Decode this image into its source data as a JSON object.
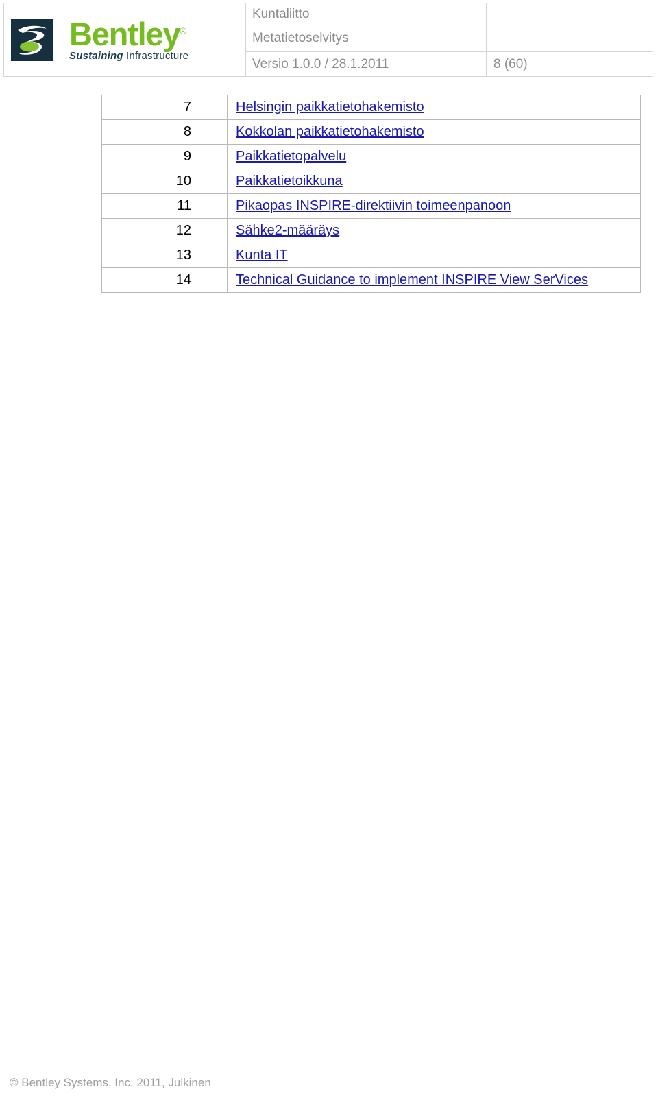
{
  "header": {
    "logo": {
      "mark_name": "bentley-b-mark",
      "wordmark": "Bentley",
      "registered_symbol": "®",
      "tagline_bold": "Sustaining",
      "tagline_regular": "Infrastructure",
      "brand_green": "#76bc21",
      "brand_navy": "#16303f"
    },
    "rows": [
      {
        "main": "Kuntaliitto",
        "side": ""
      },
      {
        "main": "Metatietoselvitys",
        "side": ""
      },
      {
        "main": "Versio 1.0.0 / 28.1.2011",
        "side": "8 (60)"
      }
    ]
  },
  "link_table": {
    "link_color": "#1a1aad",
    "rows": [
      {
        "num": "7",
        "title": "Helsingin paikkatietohakemisto"
      },
      {
        "num": "8",
        "title": "Kokkolan paikkatietohakemisto"
      },
      {
        "num": "9",
        "title": "Paikkatietopalvelu"
      },
      {
        "num": "10",
        "title": "Paikkatietoikkuna"
      },
      {
        "num": "11",
        "title": "Pikaopas INSPIRE-direktiivin toimeenpanoon"
      },
      {
        "num": "12",
        "title": "Sähke2-määräys"
      },
      {
        "num": "13",
        "title": "Kunta IT"
      },
      {
        "num": "14",
        "title": "Technical Guidance to implement INSPIRE View SerVices"
      }
    ]
  },
  "footer": {
    "copyright": "© Bentley Systems, Inc. 2011, Julkinen"
  }
}
